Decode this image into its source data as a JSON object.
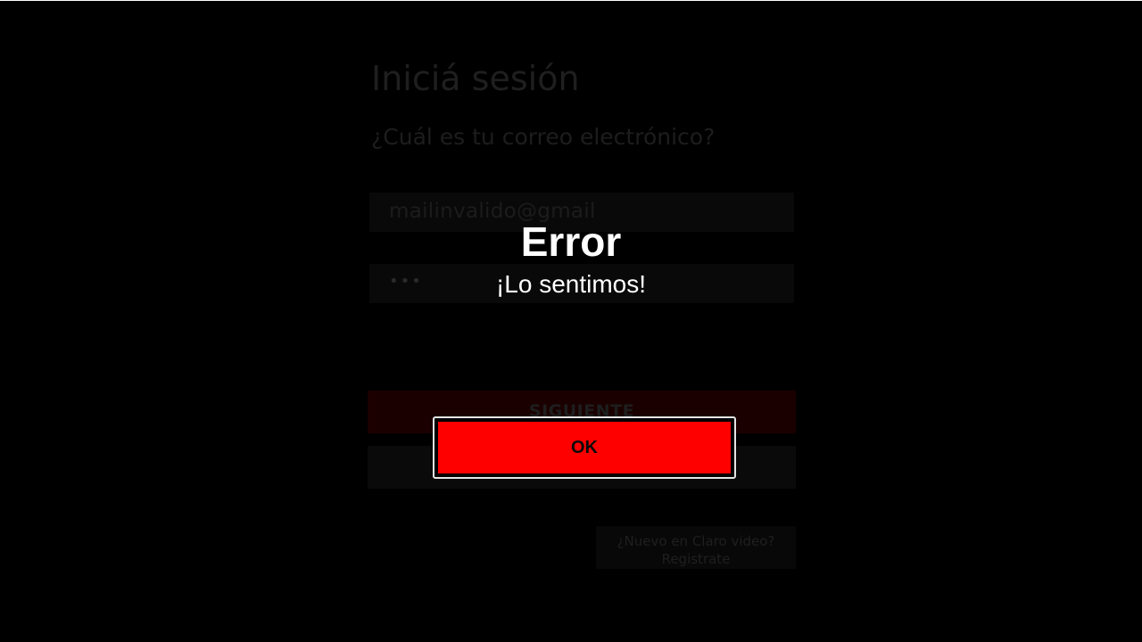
{
  "login": {
    "title": "Iniciá sesión",
    "subtitle": "¿Cuál es tu correo electrónico?",
    "email_value": "mailinvalido@gmail",
    "password_mask": "•••",
    "next_label": "SIGUIENTE",
    "register_line1": "¿Nuevo en Claro video?",
    "register_line2": "Registrate"
  },
  "modal": {
    "title": "Error",
    "message": "¡Lo sentimos!",
    "ok_label": "OK"
  },
  "colors": {
    "accent": "#ff0000",
    "background": "#000000",
    "text": "#ffffff"
  }
}
